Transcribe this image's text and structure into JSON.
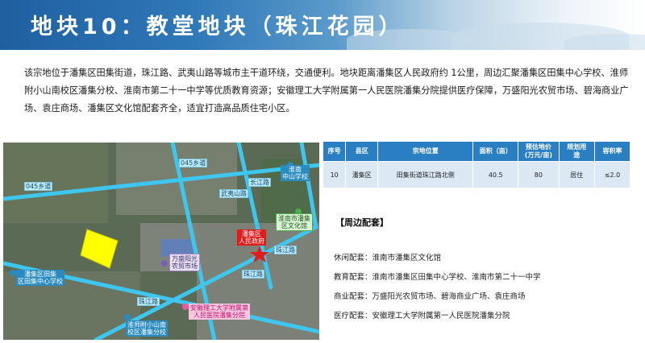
{
  "header": {
    "title": "地块10：教堂地块（珠江花园）"
  },
  "description": "该宗地位于潘集区田集街道，珠江路、武夷山路等城市主干道环绕，交通便利。地块距离潘集区人民政府约 1公里，周边汇聚潘集区田集中心学校、淮师附小山南校区潘集分校、淮南市第二十一中学等优质教育资源；安徽理工大学附属第一人民医院潘集分院提供医疗保障，万盛阳光农贸市场、碧海商业广场、袁庄商场、潘集区文化馆配套齐全，适宜打造高品质住宅小区。",
  "map": {
    "roads": {
      "r045_left": "045乡道",
      "r045_right": "045乡道",
      "wuyishan": "武夷山路",
      "changjiang": "长江路",
      "zhujiang_top": "珠江路",
      "zhujiang_mid": "珠江路",
      "zhujiang_bot": "珠江路"
    },
    "pois": {
      "huainan_school": "淮南\n中山学校",
      "culture_center": "淮南市潘集\n区文化馆",
      "gov": "潘集区\n人民政府",
      "market": "万盛阳光\n农贸市场",
      "tianji_school": "潘集区田集\n区田集中心学校",
      "hospital": "安徽理工大学附属第\n人民医院潘集分院",
      "huaishi_school": "淮师附小山南\n校区潘集分校"
    },
    "colors": {
      "parcel": "#ffff00",
      "road": "#3ec6ee",
      "marker": "#e21b1b"
    }
  },
  "table": {
    "headers": [
      "序号",
      "县区",
      "宗地位置",
      "面积（亩）",
      "预估地价\n(万元/亩)",
      "规划用\n途",
      "容积率"
    ],
    "rows": [
      [
        "10",
        "潘集区",
        "田集街道珠江路北侧",
        "40.5",
        "80",
        "居住",
        "≤2.0"
      ]
    ]
  },
  "amenities": {
    "title": "【周边配套】",
    "items": [
      {
        "label": "休闲配套：",
        "value": "淮南市潘集区文化馆"
      },
      {
        "label": "教育配套：",
        "value": "淮南市潘集区田集中心学校、淮南市第二十一中学"
      },
      {
        "label": "商业配套：",
        "value": "万盛阳光农贸市场、碧海商业广场、袁庄商场"
      },
      {
        "label": "医疗配套：",
        "value": "安徽理工大学附属第一人民医院潘集分院"
      }
    ]
  }
}
